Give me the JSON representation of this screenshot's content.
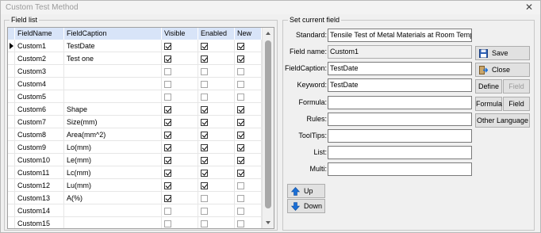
{
  "window": {
    "title": "Custom Test Method",
    "close_glyph": "✕"
  },
  "field_list": {
    "group_label": "Field list",
    "columns": [
      "FieldName",
      "FieldCaption",
      "Visible",
      "Enabled",
      "New"
    ],
    "rows": [
      {
        "name": "Custom1",
        "caption": "TestDate",
        "visible": true,
        "enabled": true,
        "new": true,
        "current": true
      },
      {
        "name": "Custom2",
        "caption": "Test one",
        "visible": true,
        "enabled": true,
        "new": true
      },
      {
        "name": "Custom3",
        "caption": "",
        "visible": false,
        "enabled": false,
        "new": false
      },
      {
        "name": "Custom4",
        "caption": "",
        "visible": false,
        "enabled": false,
        "new": false
      },
      {
        "name": "Custom5",
        "caption": "",
        "visible": false,
        "enabled": false,
        "new": false
      },
      {
        "name": "Custom6",
        "caption": "Shape",
        "visible": true,
        "enabled": true,
        "new": true
      },
      {
        "name": "Custom7",
        "caption": "Size(mm)",
        "visible": true,
        "enabled": true,
        "new": true
      },
      {
        "name": "Custom8",
        "caption": "Area(mm^2)",
        "visible": true,
        "enabled": true,
        "new": true
      },
      {
        "name": "Custom9",
        "caption": "Lo(mm)",
        "visible": true,
        "enabled": true,
        "new": true
      },
      {
        "name": "Custom10",
        "caption": "Le(mm)",
        "visible": true,
        "enabled": true,
        "new": true
      },
      {
        "name": "Custom11",
        "caption": "Lc(mm)",
        "visible": true,
        "enabled": true,
        "new": true
      },
      {
        "name": "Custom12",
        "caption": "Lu(mm)",
        "visible": true,
        "enabled": true,
        "new": false
      },
      {
        "name": "Custom13",
        "caption": "A(%)",
        "visible": true,
        "enabled": false,
        "new": false
      },
      {
        "name": "Custom14",
        "caption": "",
        "visible": false,
        "enabled": false,
        "new": false
      },
      {
        "name": "Custom15",
        "caption": "",
        "visible": false,
        "enabled": false,
        "new": false
      }
    ]
  },
  "current_field": {
    "group_label": "Set current field",
    "standard_label": "Standard:",
    "standard_value": "Tensile Test of Metal Materials at Room Temp",
    "field_name_label": "Field name:",
    "field_name_value": "Custom1",
    "field_caption_label": "FieldCaption:",
    "field_caption_value": "TestDate",
    "keyword_label": "Keyword:",
    "keyword_value": "TestDate",
    "formula_label": "Formula:",
    "formula_value": "",
    "rules_label": "Rules:",
    "rules_value": "",
    "tooltips_label": "ToolTips:",
    "tooltips_value": "",
    "list_label": "List:",
    "list_value": "",
    "multi_label": "Multi:",
    "multi_value": ""
  },
  "buttons": {
    "save": "Save",
    "close": "Close",
    "define": "Define",
    "field_disabled": "Field",
    "formula": "Formula",
    "field": "Field",
    "other_language": "Other Language",
    "up": "Up",
    "down": "Down"
  },
  "colors": {
    "header_bg": "#d8e4f8",
    "arrow_blue": "#1a6fd6"
  },
  "icons": {
    "save": "floppy-disk-icon",
    "close": "exit-door-icon",
    "up": "arrow-up-icon",
    "down": "arrow-down-icon"
  }
}
